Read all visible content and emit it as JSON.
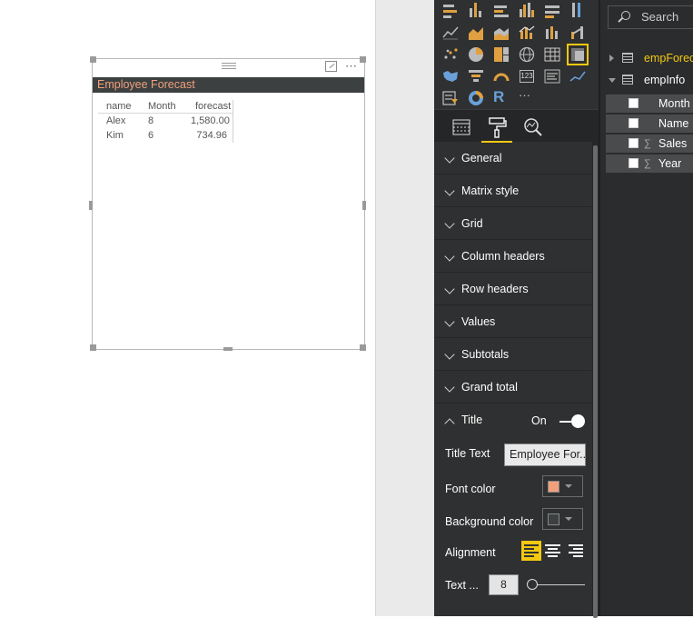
{
  "visual": {
    "title": "Employee Forecast",
    "columns": [
      "name",
      "Month",
      "forecast"
    ],
    "rows": [
      [
        "Alex",
        "8",
        "1,580.00"
      ],
      [
        "Kim",
        "6",
        "734.96"
      ]
    ],
    "title_font_color": "#f2a07c",
    "title_bg_color": "#3c4040"
  },
  "format_pane": {
    "sections": [
      "General",
      "Matrix style",
      "Grid",
      "Column headers",
      "Row headers",
      "Values",
      "Subtotals",
      "Grand total"
    ],
    "title_section": {
      "label": "Title",
      "toggle_label": "On",
      "toggle_on": true,
      "title_text_label": "Title Text",
      "title_text_value": "Employee For...",
      "font_color_label": "Font color",
      "font_color": "#f2a07c",
      "bg_color_label": "Background color",
      "bg_color": "#3c4040",
      "alignment_label": "Alignment",
      "alignment_selected": "left",
      "text_size_label": "Text ...",
      "text_size_value": "8"
    },
    "tabs": [
      "fields-tab",
      "format-tab",
      "analytics-tab"
    ],
    "active_tab": "format-tab"
  },
  "gallery": {
    "more_label": "···",
    "r_label": "R",
    "card_label": "123"
  },
  "fields_pane": {
    "search_placeholder": "Search",
    "tables": [
      {
        "name": "empForecast",
        "expanded": false,
        "color": "#f2c811"
      },
      {
        "name": "empInfo",
        "expanded": true,
        "color": "#ffffff"
      }
    ],
    "fields": [
      {
        "name": "Month",
        "sigma": false
      },
      {
        "name": "Name",
        "sigma": false
      },
      {
        "name": "Sales",
        "sigma": true
      },
      {
        "name": "Year",
        "sigma": true
      }
    ]
  },
  "colors": {
    "accent": "#f2c811",
    "pane_bg": "#2f3031"
  }
}
